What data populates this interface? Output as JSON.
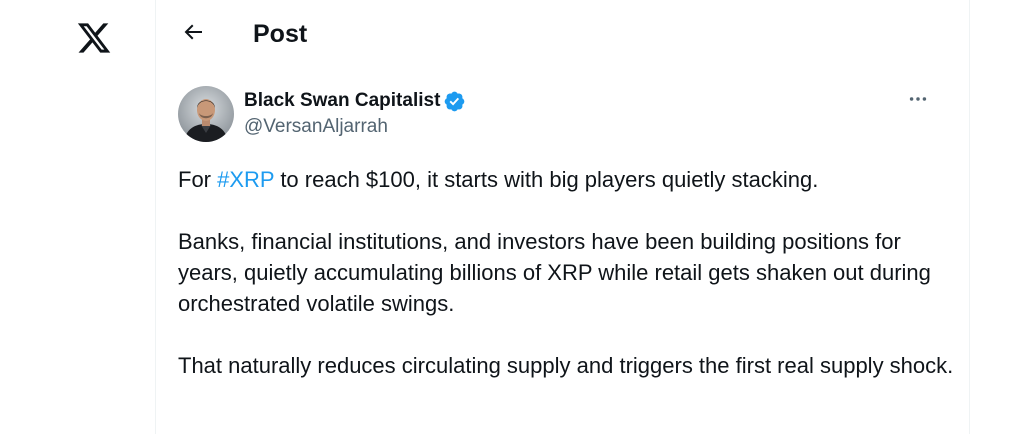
{
  "nav": {
    "logo_icon": "x-logo-icon"
  },
  "header": {
    "back_icon": "arrow-left-icon",
    "title": "Post"
  },
  "post": {
    "author": {
      "display_name": "Black Swan Capitalist",
      "handle": "@VersanAljarrah",
      "verified": true,
      "verified_color": "#1d9bf0"
    },
    "more_icon": "more-horizontal-icon",
    "body": {
      "p1_before": "For ",
      "p1_hashtag": "#XRP",
      "p1_after": " to reach $100, it starts with big players quietly stacking.",
      "p2": "Banks, financial institutions, and investors have been building positions for years, quietly accumulating billions of XRP while retail gets shaken out during orchestrated volatile swings.",
      "p3": "That naturally reduces circulating supply and triggers the first real supply shock."
    }
  },
  "colors": {
    "text": "#0f1419",
    "secondary_text": "#536471",
    "accent": "#1d9bf0",
    "border": "#eff3f4"
  }
}
